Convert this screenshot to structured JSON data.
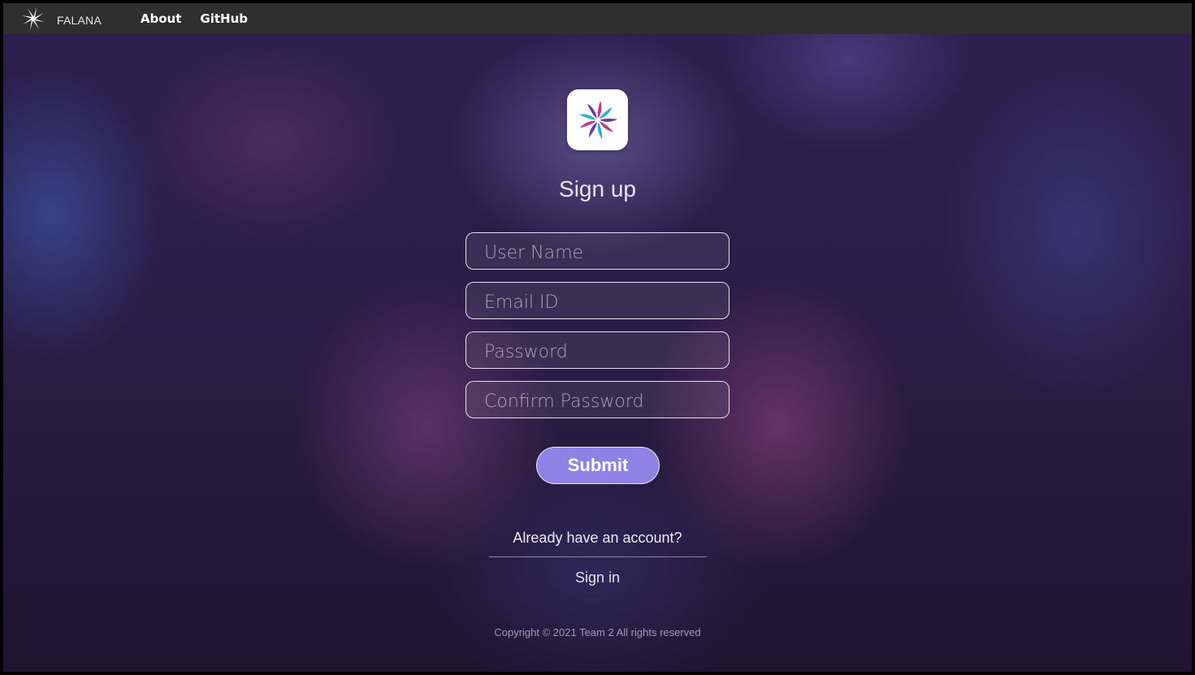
{
  "header": {
    "brand_name": "FALANA",
    "brand_icon": "falana-star-logo-icon",
    "nav": [
      {
        "label": "About"
      },
      {
        "label": "GitHub"
      }
    ]
  },
  "main": {
    "app_icon": "falana-color-logo-icon",
    "title": "Sign up",
    "fields": {
      "username": {
        "placeholder": "User Name",
        "value": ""
      },
      "email": {
        "placeholder": "Email ID",
        "value": ""
      },
      "password": {
        "placeholder": "Password",
        "value": ""
      },
      "confirm": {
        "placeholder": "Confirm Password",
        "value": ""
      }
    },
    "submit_label": "Submit",
    "account_prompt": "Already have an account?",
    "signin_label": "Sign in"
  },
  "footer": {
    "copyright": "Copyright © 2021 Team 2 All rights reserved"
  },
  "colors": {
    "topbar": "#2f2f2f",
    "submit_button": "#8f82e4",
    "logo_magenta": "#c4338a",
    "logo_teal": "#27b3c7",
    "logo_purple": "#6b3aa6"
  }
}
